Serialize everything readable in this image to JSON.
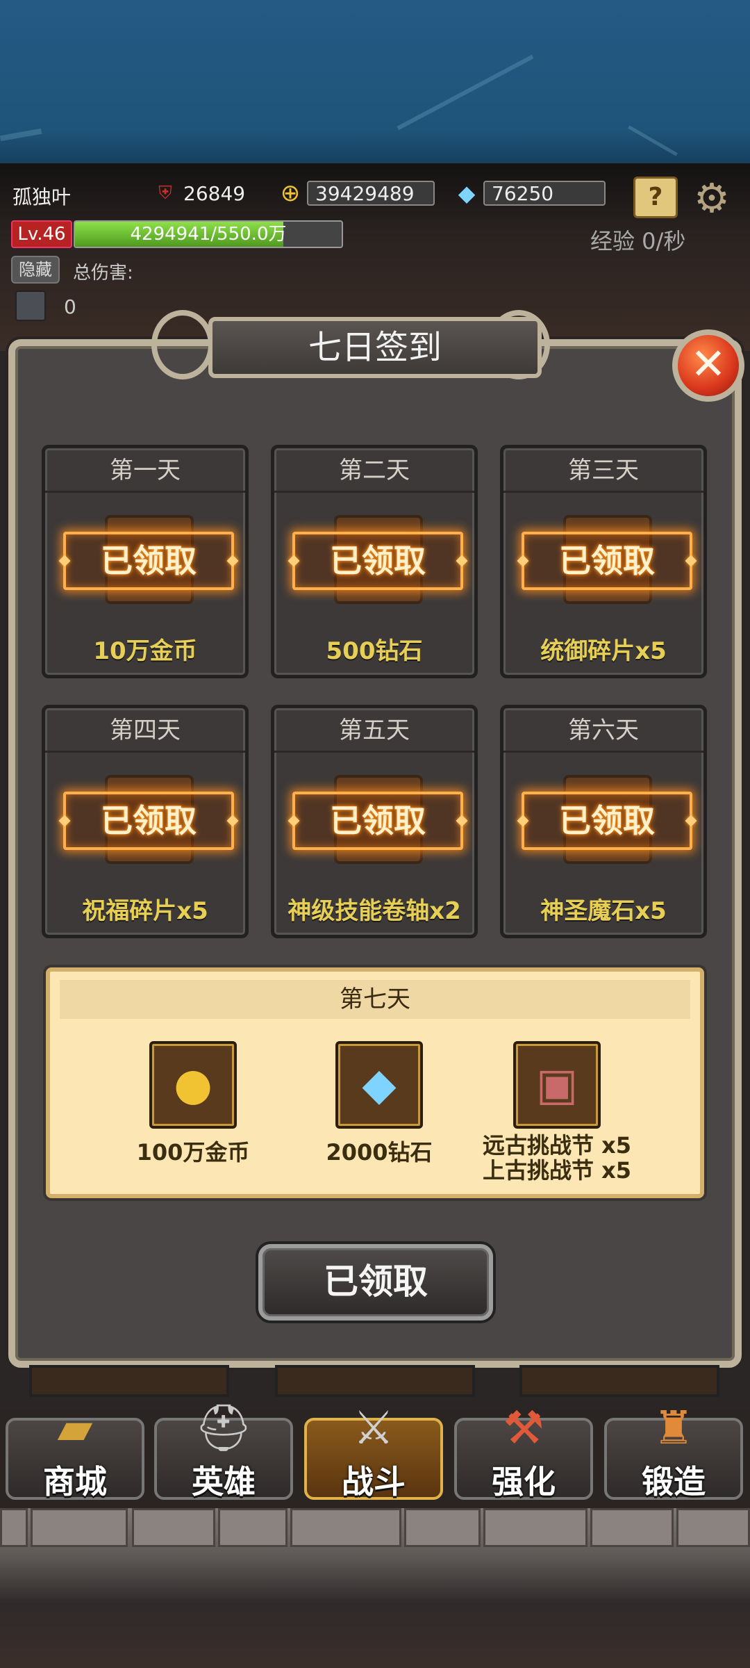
{
  "player": {
    "name": "孤独叶",
    "level": "Lv.46",
    "power": "26849",
    "gold": "39429489",
    "diamonds": "76250",
    "exp_text": "4294941/550.0万",
    "exp_progress": 0.78,
    "exp_rate": "经验 0/秒"
  },
  "hud": {
    "hide_label": "隐藏",
    "total_damage_label": "总伤害:",
    "mini_count": "0"
  },
  "dialog": {
    "title": "七日签到",
    "close_symbol": "✕",
    "days": [
      {
        "day": "第一天",
        "status": "已领取",
        "reward": "10万金币"
      },
      {
        "day": "第二天",
        "status": "已领取",
        "reward": "500钻石"
      },
      {
        "day": "第三天",
        "status": "已领取",
        "reward": "统御碎片x5"
      },
      {
        "day": "第四天",
        "status": "已领取",
        "reward": "祝福碎片x5"
      },
      {
        "day": "第五天",
        "status": "已领取",
        "reward": "神级技能卷轴x2"
      },
      {
        "day": "第六天",
        "status": "已领取",
        "reward": "神圣魔石x5"
      }
    ],
    "day7": {
      "day": "第七天",
      "rewards": [
        {
          "label": "100万金币",
          "icon": "gold-coins-icon"
        },
        {
          "label": "2000钻石",
          "icon": "diamonds-icon"
        },
        {
          "label_line1": "远古挑战节 x5",
          "label_line2": "上古挑战节 x5",
          "icon": "card-bag-icon"
        }
      ]
    },
    "claim_button": "已领取"
  },
  "nav": [
    {
      "label": "商城",
      "icon": "treasure-chest-icon"
    },
    {
      "label": "英雄",
      "icon": "knight-helmet-icon"
    },
    {
      "label": "战斗",
      "icon": "crossed-swords-icon",
      "active": true
    },
    {
      "label": "强化",
      "icon": "hammer-icon"
    },
    {
      "label": "锻造",
      "icon": "anvil-icon"
    }
  ],
  "colors": {
    "stamp_glow": "#ffb04a",
    "reward_text": "#e6cf54",
    "day7_bg": "#fbe6b4"
  }
}
